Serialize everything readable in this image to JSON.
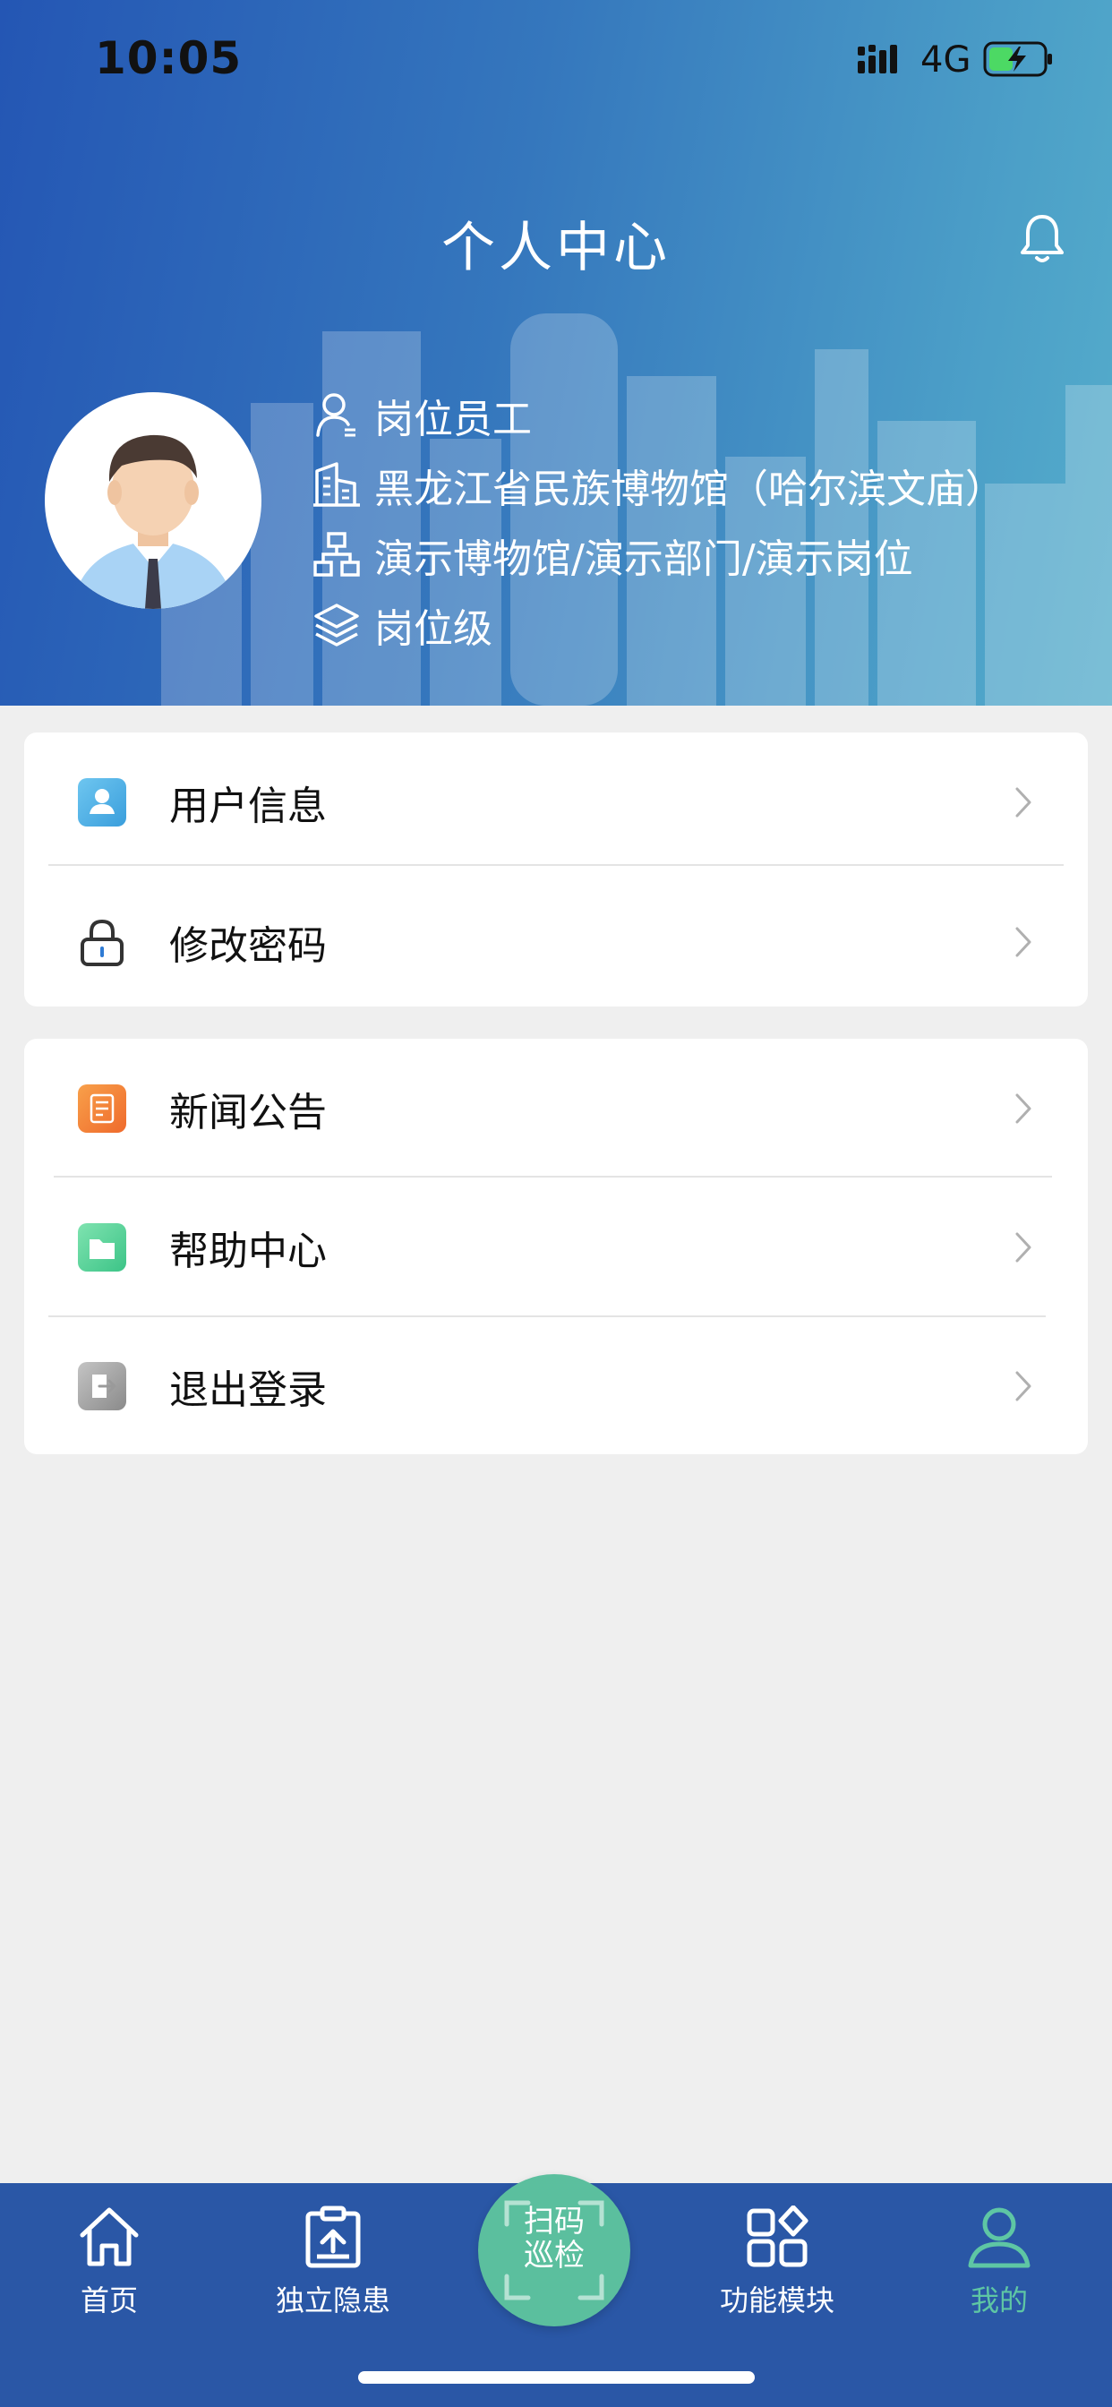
{
  "status_bar": {
    "time": "10:05",
    "network": "4G"
  },
  "header": {
    "title": "个人中心",
    "bell_icon": "bell-icon"
  },
  "profile": {
    "avatar_icon": "avatar-man",
    "role": "岗位员工",
    "organization": "黑龙江省民族博物馆（哈尔滨文庙）",
    "department_path": "演示博物馆/演示部门/演示岗位",
    "level": "岗位级"
  },
  "menu_group_1": [
    {
      "label": "用户信息",
      "icon": "user-info-icon",
      "icon_color": "#4aaee0"
    },
    {
      "label": "修改密码",
      "icon": "lock-icon",
      "icon_color": "#333333"
    }
  ],
  "menu_group_2": [
    {
      "label": "新闻公告",
      "icon": "news-icon",
      "icon_color": "#f07a35"
    },
    {
      "label": "帮助中心",
      "icon": "help-icon",
      "icon_color": "#4fcf96"
    },
    {
      "label": "退出登录",
      "icon": "logout-icon",
      "icon_color": "#9a9a9a"
    }
  ],
  "tabbar": {
    "tabs": [
      {
        "label": "首页",
        "icon": "home-icon"
      },
      {
        "label": "独立隐患",
        "icon": "clipboard-upload-icon"
      },
      {
        "label": "功能模块",
        "icon": "modules-grid-icon"
      },
      {
        "label": "我的",
        "icon": "profile-icon",
        "active": true
      }
    ],
    "scan_label_line1": "扫码",
    "scan_label_line2": "巡检"
  },
  "colors": {
    "header_start": "#2456b4",
    "header_end": "#55adcb",
    "tabbar_bg": "#2a57a6",
    "active_tab": "#5ec6a4",
    "scan_button": "#5bbf9e",
    "background": "#efefef"
  }
}
